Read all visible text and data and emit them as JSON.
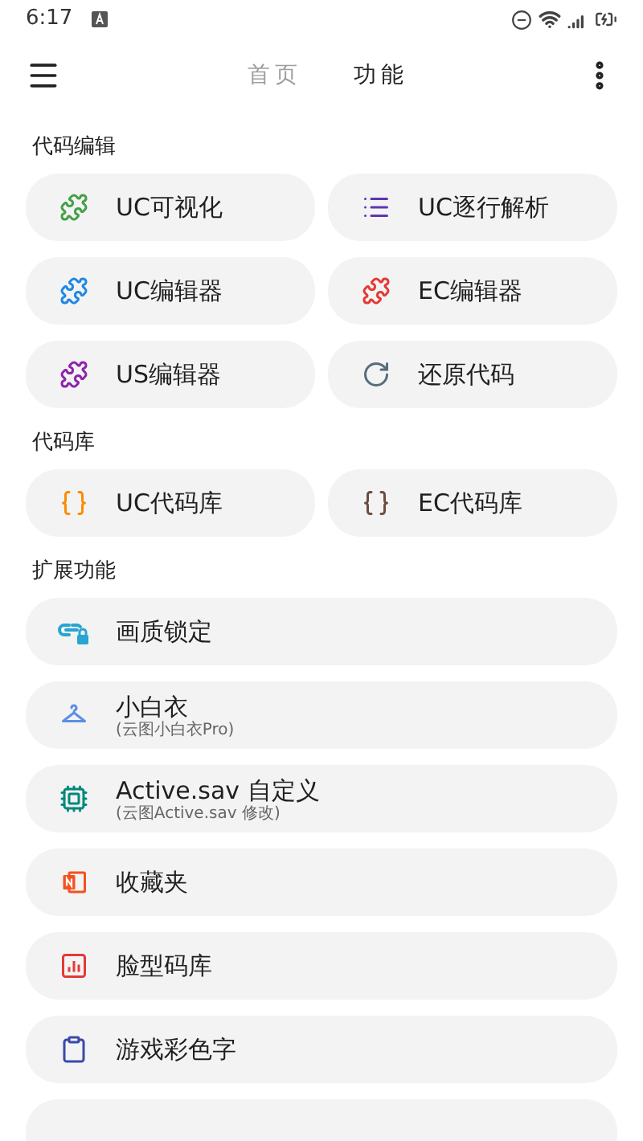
{
  "status_bar": {
    "time": "6:17"
  },
  "tabs": [
    {
      "label": "首页",
      "selected": false
    },
    {
      "label": "功能",
      "selected": true
    }
  ],
  "sections": [
    {
      "title": "代码编辑",
      "kind": "grid",
      "items": [
        {
          "label": "UC可视化",
          "kind": "puzzle",
          "color": "#43a047"
        },
        {
          "label": "UC逐行解析",
          "kind": "list",
          "color": "#5e35b1"
        },
        {
          "label": "UC编辑器",
          "kind": "puzzle",
          "color": "#1e88e5"
        },
        {
          "label": "EC编辑器",
          "kind": "puzzle",
          "color": "#e53935"
        },
        {
          "label": "US编辑器",
          "kind": "puzzle",
          "color": "#8e24aa"
        },
        {
          "label": "还原代码",
          "kind": "restore",
          "color": "#546e7a"
        }
      ]
    },
    {
      "title": "代码库",
      "kind": "grid",
      "items": [
        {
          "label": "UC代码库",
          "kind": "braces",
          "color": "#fb8c00"
        },
        {
          "label": "EC代码库",
          "kind": "braces",
          "color": "#6d4c41"
        }
      ]
    },
    {
      "title": "扩展功能",
      "kind": "list",
      "items": [
        {
          "label": "画质锁定",
          "kind": "link-lock",
          "color": "#26a6d1"
        },
        {
          "label": "小白衣",
          "subtitle": "(云图小白衣Pro)",
          "kind": "hanger",
          "color": "#5c8ee6"
        },
        {
          "label": "Active.sav 自定义",
          "subtitle": "(云图Active.sav 修改)",
          "kind": "chip",
          "color": "#00897b"
        },
        {
          "label": "收藏夹",
          "kind": "notebook",
          "color": "#f4511e"
        },
        {
          "label": "脸型码库",
          "kind": "chart",
          "color": "#e53935"
        },
        {
          "label": "游戏彩色字",
          "kind": "clipboard",
          "color": "#3949ab"
        }
      ]
    }
  ]
}
